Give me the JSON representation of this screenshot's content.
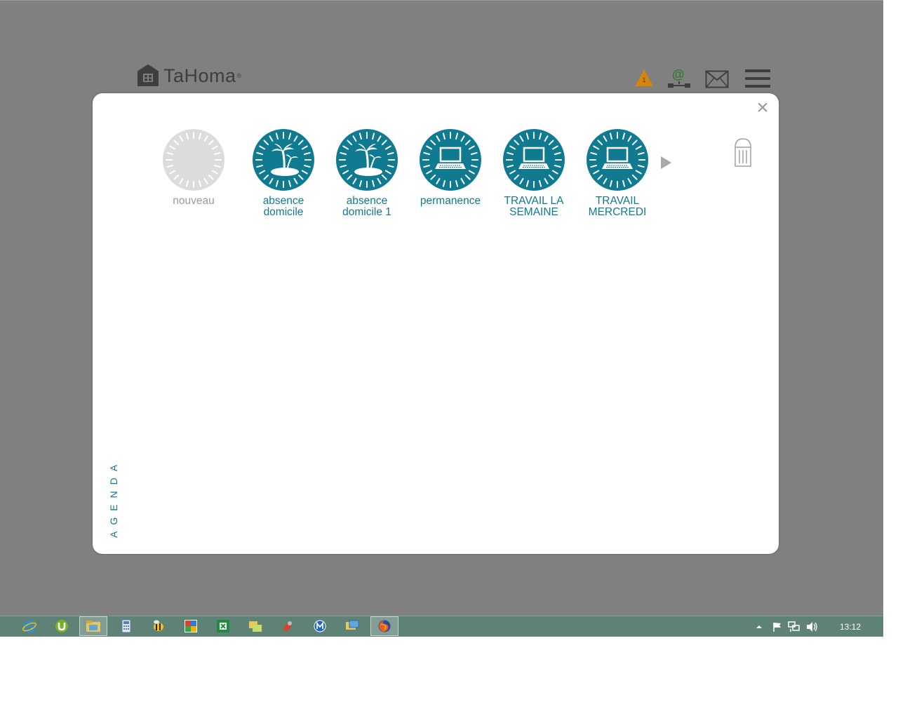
{
  "app": {
    "brand": "TaHoma",
    "brand_mark": "®"
  },
  "header": {
    "alert_count": "1",
    "connection_symbol": "@",
    "icons": [
      "warning-icon",
      "connection-icon",
      "mail-icon",
      "menu-icon"
    ]
  },
  "modal": {
    "close_label": "×",
    "side_title": "AGENDA",
    "scenarios": [
      {
        "label": "nouveau",
        "icon": "empty-clock-icon",
        "state": "new"
      },
      {
        "label": "absence\ndomicile",
        "icon": "palm-island-icon"
      },
      {
        "label": "absence\ndomicile 1",
        "icon": "palm-island-icon"
      },
      {
        "label": "permanence",
        "icon": "laptop-icon"
      },
      {
        "label": "TRAVAIL LA\nSEMAINE",
        "icon": "laptop-icon"
      },
      {
        "label": "TRAVAIL\nMERCREDI",
        "icon": "laptop-icon"
      }
    ]
  },
  "taskbar": {
    "apps": [
      "internet-explorer-icon",
      "utorrent-icon",
      "file-explorer-icon",
      "calculator-icon",
      "bee-app-icon",
      "picasa-icon",
      "excel-icon",
      "folders-icon",
      "tools-icon",
      "malwarebytes-icon",
      "remote-desktop-icon",
      "firefox-icon"
    ],
    "active_app": "firefox-icon",
    "tray_icons": [
      "show-hidden-icons-icon",
      "action-center-flag-icon",
      "network-icon",
      "volume-icon"
    ],
    "clock": "13:12"
  },
  "colors": {
    "accent": "#0f7a90",
    "background": "#808080",
    "taskbar": "#5f8276",
    "alert": "#d4860c"
  }
}
